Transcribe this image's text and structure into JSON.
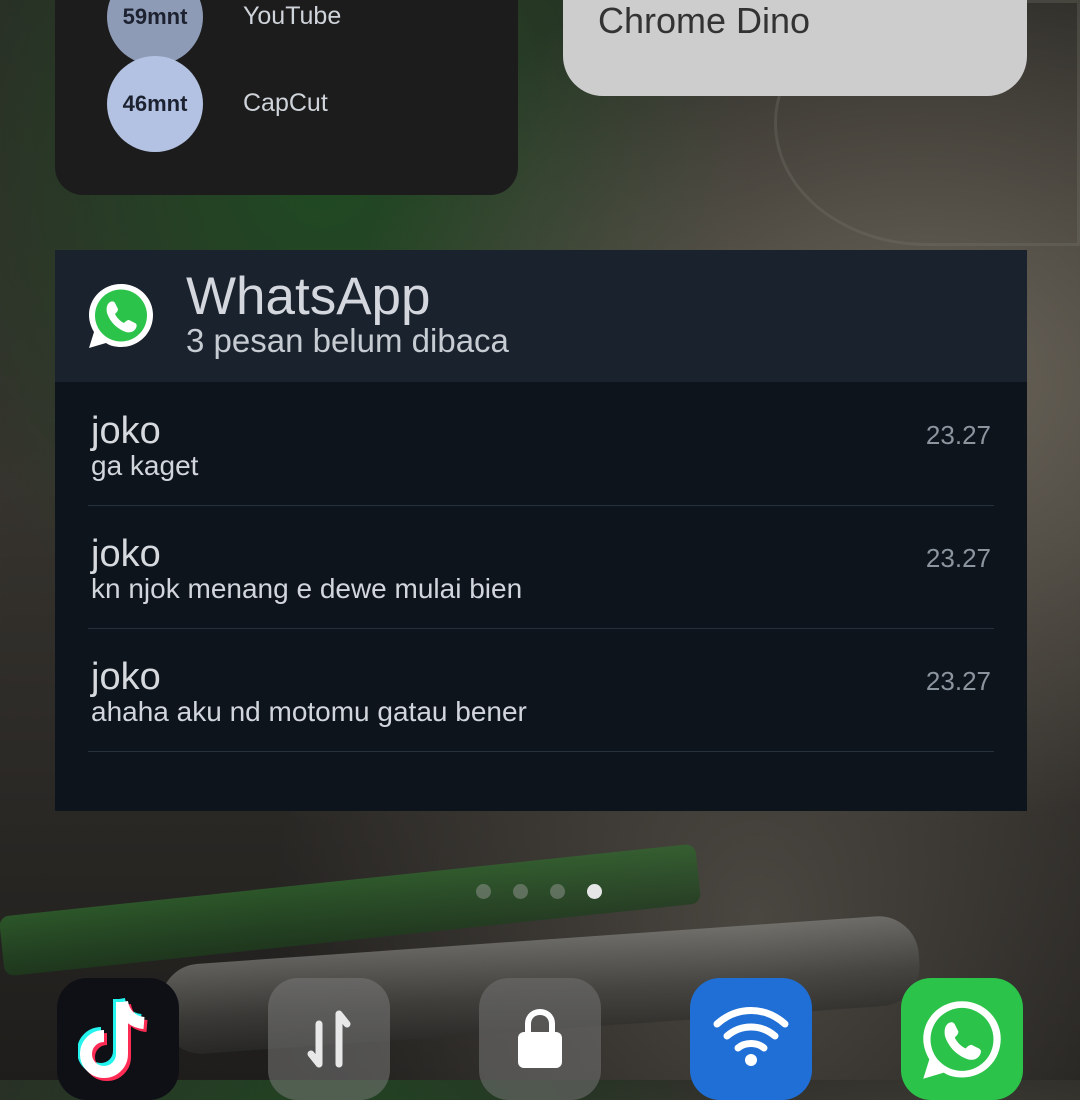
{
  "usage_widget": {
    "rows": [
      {
        "time": "59mnt",
        "app": "YouTube"
      },
      {
        "time": "46mnt",
        "app": "CapCut"
      }
    ]
  },
  "dino_widget": {
    "label": "Chrome Dino"
  },
  "whatsapp_widget": {
    "title": "WhatsApp",
    "subtitle": "3 pesan belum dibaca",
    "messages": [
      {
        "sender": "joko",
        "text": "ga kaget",
        "time": "23.27"
      },
      {
        "sender": "joko",
        "text": "kn njok menang e dewe mulai bien",
        "time": "23.27"
      },
      {
        "sender": "joko",
        "text": "ahaha aku nd motomu gatau bener",
        "time": "23.27"
      }
    ]
  },
  "page_indicator": {
    "count": 4,
    "active_index": 3
  },
  "dock": {
    "icons": [
      "tiktok-icon",
      "mobile-data-icon",
      "lock-icon",
      "wifi-icon",
      "whatsapp-icon"
    ],
    "colors": {
      "wifi": "#1f6fd6",
      "whatsapp": "#2cc34a",
      "tiktok": "#0f0f16"
    }
  }
}
